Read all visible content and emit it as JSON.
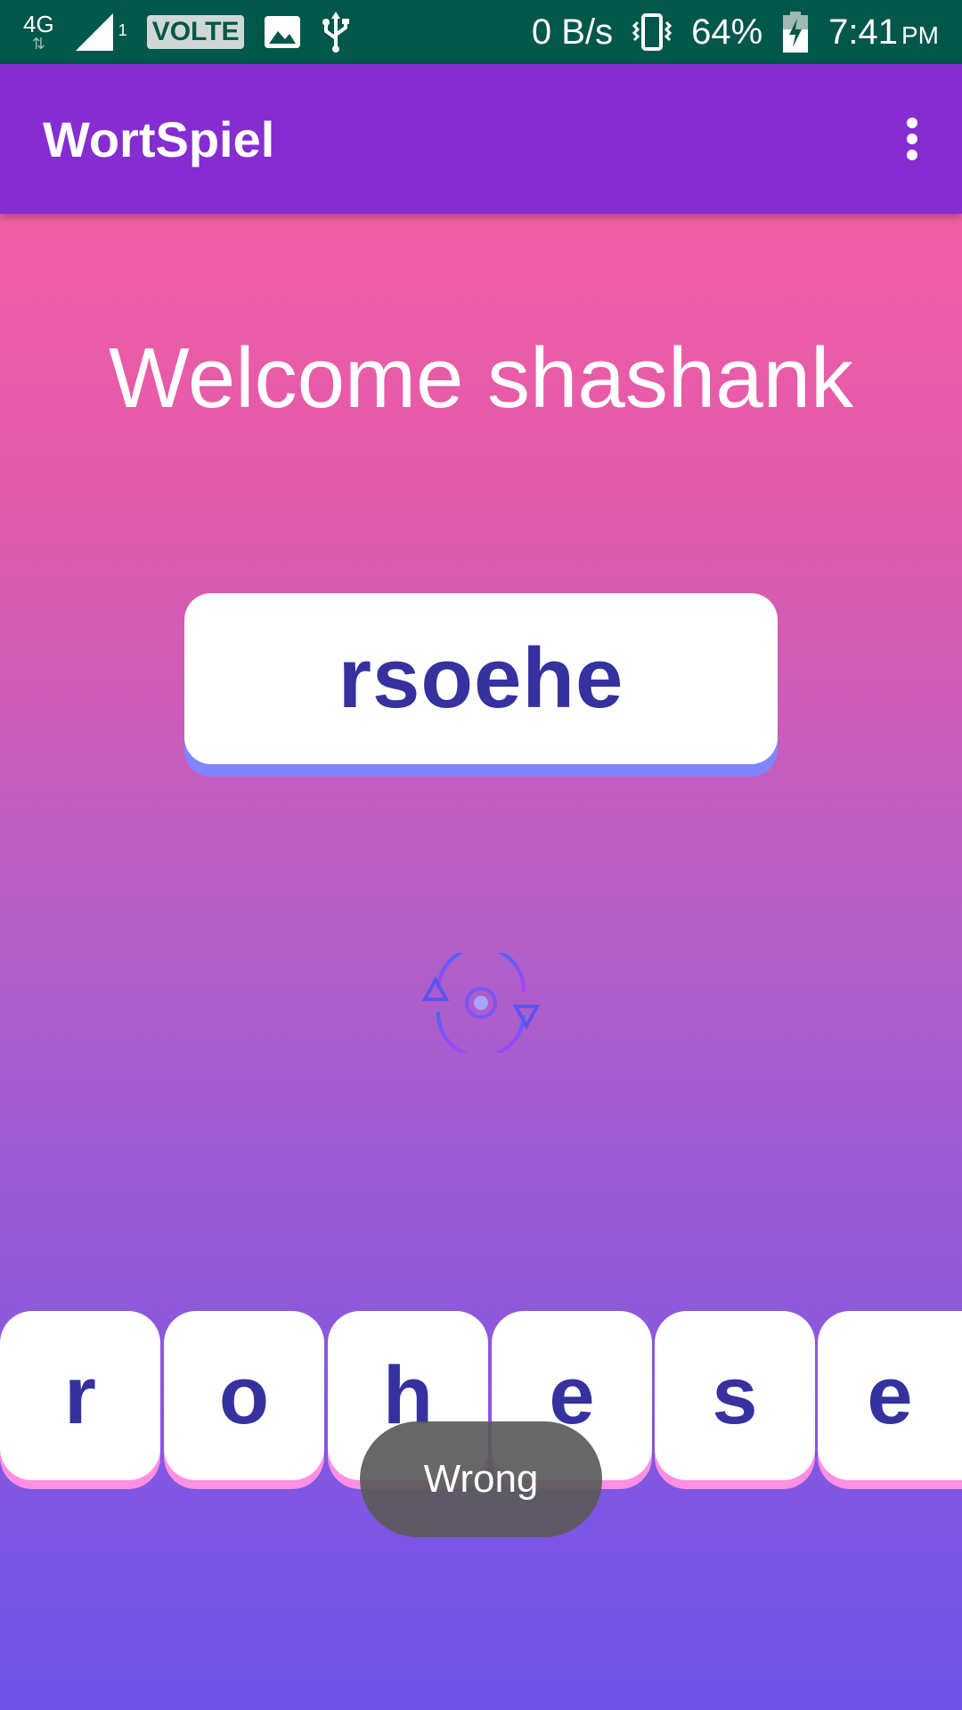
{
  "status_bar": {
    "network": "4G",
    "sim_slot": "1",
    "volte": "VOLTE",
    "speed": "0 B/s",
    "battery": "64%",
    "time": "7:41",
    "time_suffix": "PM"
  },
  "app_bar": {
    "title": "WortSpiel",
    "menu_icon": "more-vert-icon"
  },
  "main": {
    "welcome": "Welcome shashank",
    "scrambled_word": "rsoehe",
    "refresh_icon": "refresh-icon",
    "tiles": [
      "r",
      "o",
      "h",
      "e",
      "s",
      "e"
    ]
  },
  "toast": {
    "message": "Wrong"
  },
  "colors": {
    "status_bar": "#02574b",
    "app_bar": "#852dd0",
    "word_text": "#35319e",
    "card_shadow": "#7e86ff",
    "tile_shadow": "#ff8fe3"
  }
}
